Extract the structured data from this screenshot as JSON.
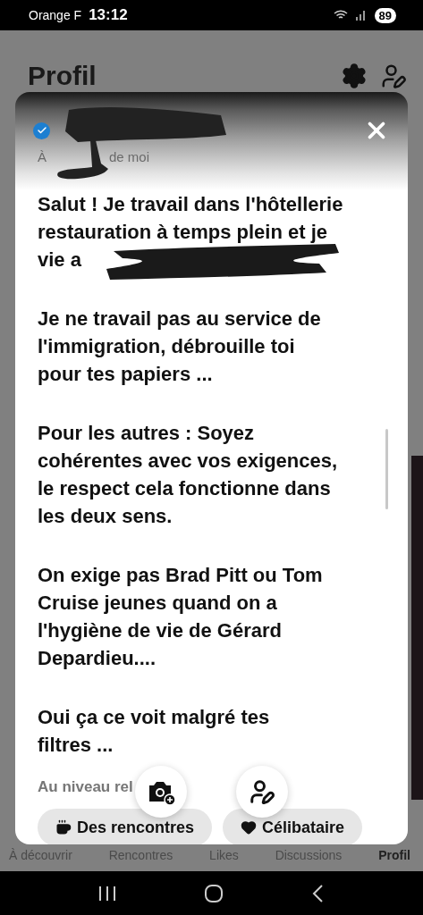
{
  "status_bar": {
    "carrier": "Orange F",
    "time": "13:12",
    "battery": "89"
  },
  "page": {
    "title": "Profil"
  },
  "profile_sheet": {
    "verified": true,
    "subtitle_parts": [
      "À",
      "de moi"
    ],
    "paragraphs": [
      {
        "lines": [
          "Salut ! Je travail dans l'hôtellerie",
          "restauration à temps plein et je",
          "vie a"
        ]
      },
      {
        "lines": [
          "Je ne travail pas au service de",
          "l'immigration, débrouille toi",
          "pour tes papiers ..."
        ]
      },
      {
        "lines": [
          "Pour les autres : Soyez",
          "cohérentes avec vos exigences,",
          "le respect cela fonctionne dans",
          "les deux sens."
        ]
      },
      {
        "lines": [
          "On exige pas Brad Pitt ou Tom",
          "Cruise jeunes quand on a",
          "l'hygiène de vie de Gérard",
          "Depardieu...."
        ]
      },
      {
        "lines": [
          "Oui ça ce voit malgré tes",
          "filtres ..."
        ]
      }
    ],
    "section_label": "Au niveau rel",
    "chips": [
      {
        "label": "Des rencontres",
        "kind": "cup"
      },
      {
        "label": "Célibataire",
        "kind": "heart"
      }
    ]
  },
  "tab_bar": [
    {
      "label": "À découvrir",
      "selected": false
    },
    {
      "label": "Rencontres",
      "selected": false
    },
    {
      "label": "Likes",
      "selected": false
    },
    {
      "label": "Discussions",
      "selected": false
    },
    {
      "label": "Profil",
      "selected": true
    }
  ]
}
